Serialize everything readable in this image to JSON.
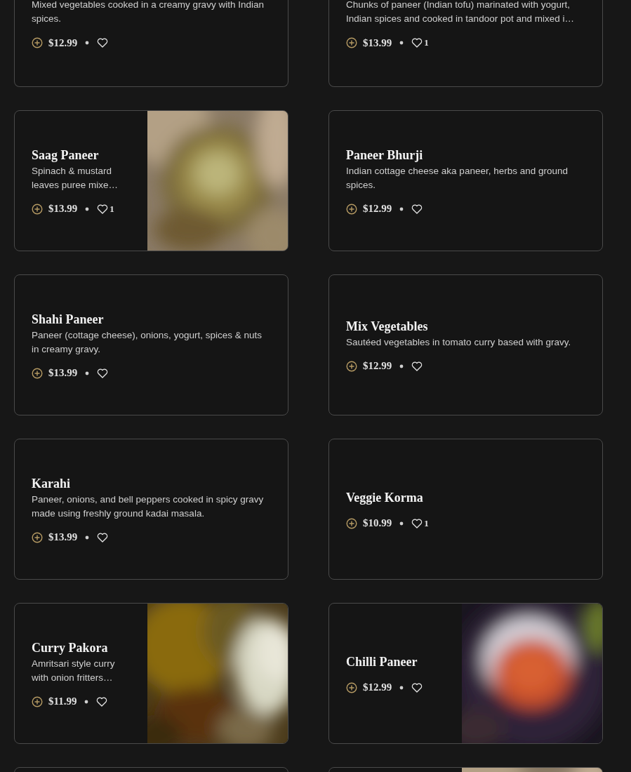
{
  "menu_items": [
    {
      "kind": "plain",
      "description": "Mixed vegetables cooked in a creamy gravy with Indian spices.",
      "price": "$12.99"
    },
    {
      "kind": "plain",
      "description": "Chunks of paneer (Indian tofu) marinated with yogurt, Indian spices and cooked in tandoor pot and mixed i…",
      "price": "$13.99",
      "likes": "1"
    },
    {
      "kind": "picture",
      "title": "Saag Paneer",
      "description": "Spinach & mustard leaves puree mixe…",
      "price": "$13.99",
      "likes": "1"
    },
    {
      "kind": "plain",
      "title": "Paneer Bhurji",
      "description": "Indian cottage cheese aka paneer, herbs and ground spices.",
      "price": "$12.99"
    },
    {
      "kind": "plain",
      "title": "Shahi Paneer",
      "description": "Paneer (cottage cheese), onions, yogurt, spices & nuts in creamy gravy.",
      "price": "$13.99"
    },
    {
      "kind": "plain",
      "title": "Mix Vegetables",
      "description": "Sautéed vegetables in tomato curry based with gravy.",
      "price": "$12.99"
    },
    {
      "kind": "plain",
      "title": "Karahi",
      "description": "Paneer, onions, and bell peppers cooked in spicy gravy made using freshly ground kadai masala.",
      "price": "$13.99"
    },
    {
      "kind": "plain",
      "title": "Veggie Korma",
      "price": "$10.99",
      "likes": "1"
    },
    {
      "kind": "picture",
      "title": "Curry Pakora",
      "description": "Amritsari style curry with onion fritters…",
      "price": "$11.99"
    },
    {
      "kind": "picture",
      "title": "Chilli Paneer",
      "price": "$12.99"
    },
    {
      "kind": "plain"
    },
    {
      "kind": "picture"
    }
  ]
}
